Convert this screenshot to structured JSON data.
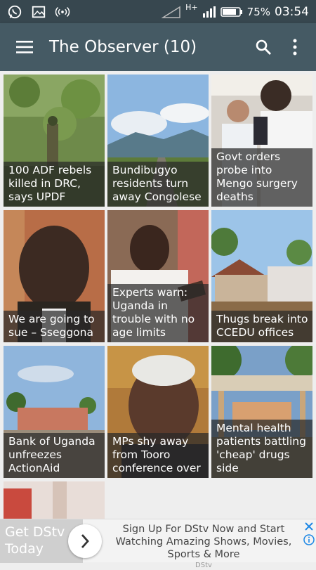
{
  "status_bar": {
    "icons": [
      "whatsapp-icon",
      "gallery-icon",
      "hotspot-icon"
    ],
    "network": "H+",
    "battery": "75%",
    "time": "03:54"
  },
  "app_bar": {
    "title": "The Observer (10)",
    "icons": [
      "menu-icon",
      "search-icon",
      "more-vert-icon"
    ]
  },
  "articles": [
    {
      "headline": "100 ADF rebels killed in DRC, says UPDF"
    },
    {
      "headline": "Bundibugyo residents turn away Congolese"
    },
    {
      "headline": "Govt orders probe into Mengo surgery deaths"
    },
    {
      "headline": "We are going to sue – Sseggona"
    },
    {
      "headline": "Experts warn: Uganda in trouble with no age limits"
    },
    {
      "headline": "Thugs break into CCEDU offices"
    },
    {
      "headline": "Bank of Uganda unfreezes ActionAid"
    },
    {
      "headline": "MPs shy away from Tooro conference over"
    },
    {
      "headline": "Mental health patients battling 'cheap' drugs side"
    }
  ],
  "ad": {
    "left_text": "Get DStv Today",
    "text": "Sign Up For DStv Now and Start Watching Amazing Shows, Movies, Sports & More",
    "brand": "DStv",
    "icons": [
      "chevron-right-icon",
      "close-icon",
      "info-icon"
    ]
  }
}
